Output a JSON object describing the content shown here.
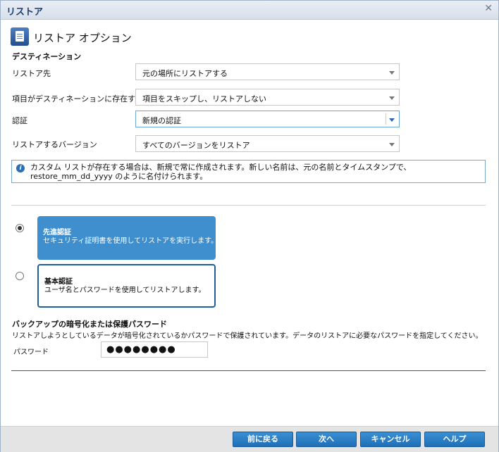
{
  "window": {
    "title": "リストア"
  },
  "header": {
    "title": "リストア オプション"
  },
  "destination": {
    "section": "デスティネーション",
    "rows": [
      {
        "label": "リストア先",
        "value": "元の場所にリストアする"
      },
      {
        "label": "項目がデスティネーションに存在する場合",
        "value": "項目をスキップし、リストアしない"
      },
      {
        "label": "認証",
        "value": "新規の認証"
      },
      {
        "label": "リストアするバージョン",
        "value": "すべてのバージョンをリストア"
      }
    ]
  },
  "info": {
    "text": "カスタム リストが存在する場合は、新規で常に作成されます。新しい名前は、元の名前とタイムスタンプで、restore_mm_dd_yyyy のように名付けられます。"
  },
  "auth": {
    "options": [
      {
        "title": "先進認証",
        "description": "セキュリティ証明書を使用してリストアを実行します。",
        "checked": true
      },
      {
        "title": "基本認証",
        "description": "ユーザ名とパスワードを使用してリストアします。",
        "checked": false
      }
    ]
  },
  "password": {
    "title": "バックアップの暗号化または保護パスワード",
    "description": "リストアしようとしているデータが暗号化されているかパスワードで保護されています。データのリストアに必要なパスワードを指定してください。",
    "label": "パスワード",
    "value": "●●●●●●●●"
  },
  "footer": {
    "back": "前に戻る",
    "next": "次へ",
    "cancel": "キャンセル",
    "help": "ヘルプ"
  },
  "colors": {
    "accent": "#3f8fcf",
    "button": "#1f6fb8"
  }
}
